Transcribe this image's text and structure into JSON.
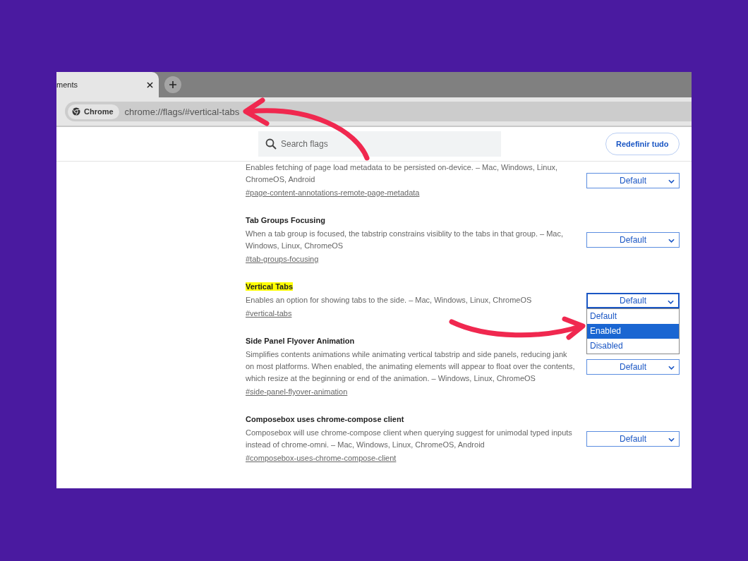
{
  "browser": {
    "tab": {
      "title": "ments",
      "selected": true
    },
    "chip": "Chrome",
    "url": "chrome://flags/#vertical-tabs"
  },
  "header": {
    "search": {
      "placeholder": "Search flags"
    },
    "reset_button": "Redefinir tudo"
  },
  "flags": [
    {
      "description": "Enables fetching of page load metadata to be persisted on-device. – Mac, Windows, Linux, ChromeOS, Android",
      "link": "#page-content-annotations-remote-page-metadata",
      "value": "Default",
      "focused": false
    },
    {
      "title": "Tab Groups Focusing",
      "description": "When a tab group is focused, the tabstrip constrains visiblity to the tabs in that group. – Mac, Windows, Linux, ChromeOS",
      "link": "#tab-groups-focusing",
      "value": "Default",
      "highlighted": false,
      "focused": false
    },
    {
      "title": "Vertical Tabs",
      "description": "Enables an option for showing tabs to the side. – Mac, Windows, Linux, ChromeOS",
      "link": "#vertical-tabs",
      "value": "Default",
      "highlighted": true,
      "focused": true,
      "options": [
        {
          "label": "Default",
          "highlighted": false
        },
        {
          "label": "Enabled",
          "highlighted": true
        },
        {
          "label": "Disabled",
          "highlighted": false
        }
      ]
    },
    {
      "title": "Side Panel Flyover Animation",
      "description": "Simplifies contents animations while animating vertical tabstrip and side panels, reducing jank on most platforms. When enabled, the animating elements will appear to float over the contents, which resize at the beginning or end of the animation. – Windows, Linux, ChromeOS",
      "link": "#side-panel-flyover-animation",
      "value": "Default",
      "highlighted": false,
      "focused": false
    },
    {
      "title": "Composebox uses chrome-compose client",
      "description": "Composebox will use chrome-compose client when querying suggest for unimodal typed inputs instead of chrome-omni. – Mac, Windows, Linux, ChromeOS, Android",
      "link": "#composebox-uses-chrome-compose-client",
      "value": "Default",
      "highlighted": false,
      "focused": false
    }
  ]
}
